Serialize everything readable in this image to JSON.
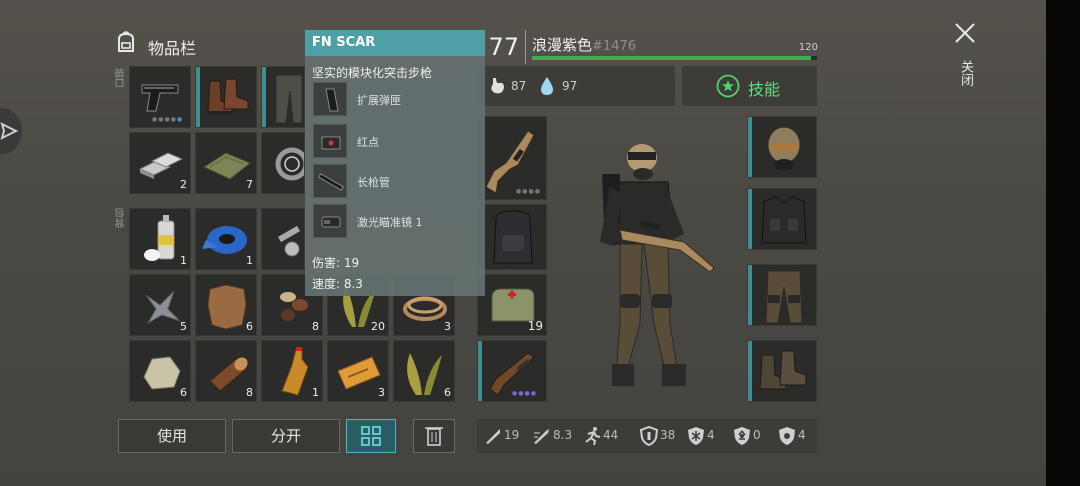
{
  "panel": {
    "title": "物品栏"
  },
  "labels": {
    "pocket": "口袋",
    "backpack": "背包",
    "close": "关闭"
  },
  "player": {
    "level": "77",
    "name": "浪漫紫色",
    "id": "#1476",
    "xp_max": "120",
    "food": "87",
    "water": "97"
  },
  "skills": {
    "label": "技能"
  },
  "tooltip": {
    "title": "FN SCAR",
    "desc": "坚实的模块化突击步枪",
    "mods": [
      "扩展弹匣",
      "红点",
      "长枪管",
      "激光瞄准镜 1"
    ],
    "damage": "伤害: 19",
    "speed": "速度: 8.3"
  },
  "pocket_slots": [
    {
      "icon": "pistol-icon",
      "count": ""
    },
    {
      "icon": "boots-icon",
      "count": ""
    },
    {
      "icon": "pants-icon",
      "count": ""
    },
    {
      "icon": "metal-ingot-icon",
      "count": "2"
    },
    {
      "icon": "cloth-icon",
      "count": "7"
    },
    {
      "icon": "bearing-icon",
      "count": ""
    }
  ],
  "backpack_slots": [
    {
      "icon": "spray-can-icon",
      "count": "1"
    },
    {
      "icon": "duct-tape-icon",
      "count": "1"
    },
    {
      "icon": "bolts-icon",
      "count": ""
    },
    {
      "icon": "metal-scrap-icon",
      "count": "5"
    },
    {
      "icon": "leather-icon",
      "count": "6"
    },
    {
      "icon": "seeds-icon",
      "count": "8"
    },
    {
      "icon": "plant-fiber-icon",
      "count": "20"
    },
    {
      "icon": "rope-icon",
      "count": "3"
    },
    {
      "icon": "stone-icon",
      "count": "6"
    },
    {
      "icon": "wood-log-icon",
      "count": "8"
    },
    {
      "icon": "bottle-icon",
      "count": "1"
    },
    {
      "icon": "coupon-icon",
      "count": "3"
    },
    {
      "icon": "plant-fiber-icon",
      "count": "6"
    }
  ],
  "mid_slots": [
    {
      "icon": "rifle-icon",
      "count": ""
    },
    {
      "icon": "backpack-icon",
      "count": ""
    },
    {
      "icon": "medkit-icon",
      "count": "19"
    },
    {
      "icon": "shotgun-icon",
      "count": ""
    }
  ],
  "armor_slots": [
    "helmet-icon",
    "vest-icon",
    "armor-pants-icon",
    "armor-boots-icon"
  ],
  "bottom_stats": [
    "19",
    "8.3",
    "44",
    "38",
    "4",
    "0",
    "4"
  ],
  "buttons": {
    "use": "使用",
    "split": "分开"
  },
  "colors": {
    "accent": "#3f8f92",
    "xp_bar": "#3fae4a",
    "tooltip_header": "#4f9fa6"
  },
  "xp_progress": 0.98
}
